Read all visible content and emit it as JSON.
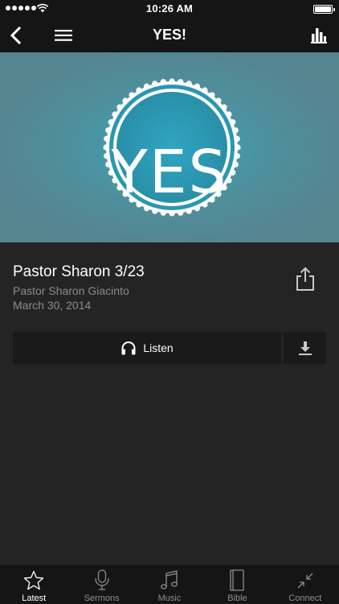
{
  "status_bar": {
    "time": "10:26 AM",
    "icons": [
      "signal-dots-icon",
      "wifi-icon",
      "battery-icon"
    ]
  },
  "nav": {
    "title": "YES!",
    "icons": [
      "chevron-left-icon",
      "hamburger-menu-icon",
      "bar-chart-icon"
    ]
  },
  "hero": {
    "artwork_text": "YES",
    "colors": {
      "background": "#56848f",
      "circle": "#2a9bb7",
      "ring": "#ffffff"
    }
  },
  "sermon": {
    "title": "Pastor Sharon 3/23",
    "speaker": "Pastor Sharon Giacinto",
    "date": "March 30, 2014",
    "share_icon": "share-icon"
  },
  "actions": {
    "listen_label": "Listen",
    "listen_icon": "headphones-icon",
    "download_icon": "download-icon"
  },
  "tab_bar": {
    "tabs": [
      {
        "label": "Latest",
        "icon": "star-icon",
        "active": true
      },
      {
        "label": "Sermons",
        "icon": "microphone-icon",
        "active": false
      },
      {
        "label": "Music",
        "icon": "music-note-icon",
        "active": false
      },
      {
        "label": "Bible",
        "icon": "book-icon",
        "active": false
      },
      {
        "label": "Connect",
        "icon": "connect-arrows-icon",
        "active": false
      }
    ]
  },
  "colors": {
    "background": "#242424",
    "bar": "#151515",
    "text_primary": "#ffffff",
    "text_secondary": "#8c8c8c"
  }
}
